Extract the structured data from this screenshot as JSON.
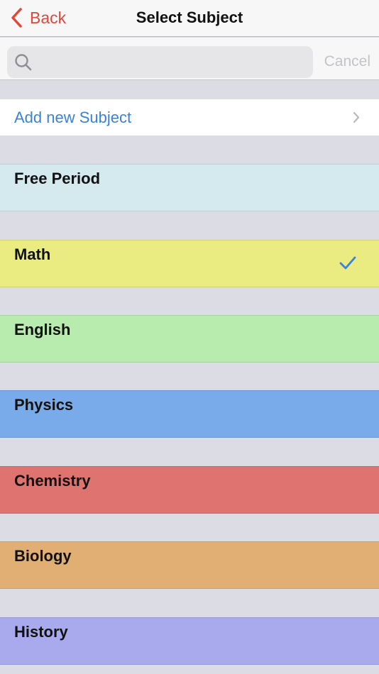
{
  "nav": {
    "back_label": "Back",
    "back_icon": "chevron-left-icon",
    "title": "Select Subject",
    "accent_color": "#e0473a"
  },
  "search": {
    "placeholder": "",
    "value": "",
    "cancel_label": "Cancel",
    "search_icon": "search-icon"
  },
  "add_new": {
    "label": "Add new Subject",
    "link_color": "#3a82d8",
    "disclosure_icon": "chevron-right-icon"
  },
  "subjects": [
    {
      "label": "Free Period",
      "color": "#d4eaee",
      "selected": false
    },
    {
      "label": "Math",
      "color": "#eaeb80",
      "selected": true
    },
    {
      "label": "English",
      "color": "#b7ecae",
      "selected": false
    },
    {
      "label": "Physics",
      "color": "#79abea",
      "selected": false
    },
    {
      "label": "Chemistry",
      "color": "#df7370",
      "selected": false
    },
    {
      "label": "Biology",
      "color": "#e1ae74",
      "selected": false
    },
    {
      "label": "History",
      "color": "#a9aaed",
      "selected": false
    }
  ],
  "selected_check_icon": "checkmark-icon",
  "check_color": "#3a82d8"
}
